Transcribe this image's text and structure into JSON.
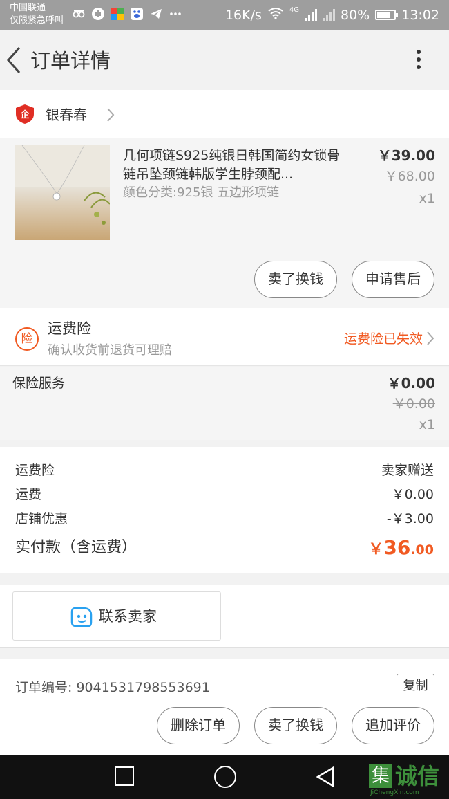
{
  "status_bar": {
    "carrier_line1": "中国联通",
    "carrier_line2": "仅限紧急呼叫",
    "icons": [
      "incognito-icon",
      "voice-icon",
      "photos-icon",
      "baidu-icon",
      "telegram-icon",
      "more-dots-icon"
    ],
    "net_speed": "16K/s",
    "network": "4G",
    "battery": "80%",
    "battery_level": 0.8,
    "time": "13:02"
  },
  "header": {
    "title": "订单详情"
  },
  "shop": {
    "name": "银春春",
    "badge_text": "企",
    "badge_color": "#e02e24"
  },
  "item": {
    "title": "几何项链S925纯银日韩国简约女锁骨链吊坠颈链韩版学生脖颈配...",
    "sku": "颜色分类:925银 五边形项链",
    "price": "￥39.00",
    "original_price": "￥68.00",
    "quantity": "x1",
    "buttons": {
      "sell": "卖了换钱",
      "after_sale": "申请售后"
    }
  },
  "insurance": {
    "icon_text": "险",
    "title": "运费险",
    "subtitle": "确认收货前退货可理赔",
    "status": "运费险已失效",
    "accent_color": "#f15a22"
  },
  "service": {
    "label": "保险服务",
    "price": "￥0.00",
    "original_price": "￥0.00",
    "quantity": "x1"
  },
  "summary": {
    "rows": [
      {
        "label": "运费险",
        "value": "卖家赠送"
      },
      {
        "label": "运费",
        "value": "￥0.00"
      },
      {
        "label": "店铺优惠",
        "value": "-￥3.00"
      }
    ],
    "total_label": "实付款（含运费）",
    "total_currency": "￥",
    "total_integer": "36",
    "total_decimal": ".00"
  },
  "contact": {
    "label": "联系卖家"
  },
  "order": {
    "number_label": "订单编号: 9041531798553691",
    "copy_label": "复制"
  },
  "actions": {
    "delete": "删除订单",
    "sell": "卖了换钱",
    "review": "追加评价"
  },
  "watermark": {
    "box_char": "集",
    "text": "诚信",
    "sub": "JiChengXin.com"
  }
}
